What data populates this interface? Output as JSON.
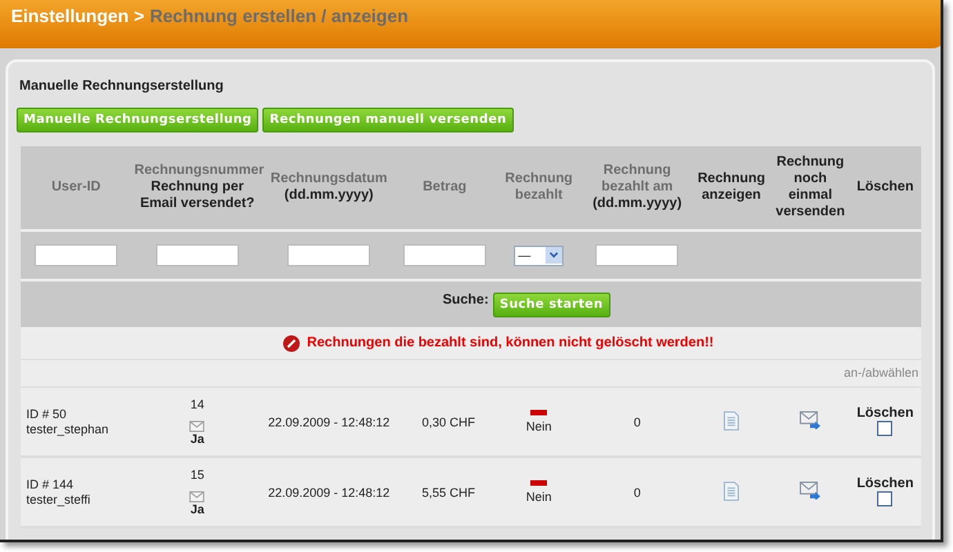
{
  "breadcrumb": {
    "root": "Einstellungen >",
    "current": "Rechnung erstellen / anzeigen"
  },
  "section_title": "Manuelle Rechnungserstellung",
  "buttons": [
    "Manuelle Rechnungserstellung",
    "Rechnungen manuell versenden"
  ],
  "table": {
    "columns": [
      {
        "label": "User-ID",
        "sortable": true
      },
      {
        "label": "Rechnungsnummer",
        "sublabel": "Rechnung per Email versendet?",
        "sortable": true
      },
      {
        "label": "Rechnungsdatum",
        "sublabel": "(dd.mm.yyyy)",
        "sortable": true
      },
      {
        "label": "Betrag",
        "sortable": true
      },
      {
        "label": "Rechnung bezahlt",
        "sortable": true
      },
      {
        "label": "Rechnung bezahlt am",
        "sublabel": "(dd.mm.yyyy)",
        "sortable": true
      },
      {
        "label": "Rechnung anzeigen",
        "sortable": false
      },
      {
        "label": "Rechnung noch einmal versenden",
        "sortable": false
      },
      {
        "label": "Löschen",
        "sortable": false
      }
    ],
    "filters": [
      {
        "kind": "text"
      },
      {
        "kind": "text"
      },
      {
        "kind": "text"
      },
      {
        "kind": "text"
      },
      {
        "kind": "select",
        "value": "—"
      },
      {
        "kind": "text"
      }
    ],
    "search": {
      "label": "Suche:",
      "button": "Suche starten"
    },
    "warning": "Rechnungen die bezahlt sind, können nicht gelöscht werden!!",
    "toggle_all": "an-/abwählen",
    "rows": [
      {
        "user_id": "ID # 50",
        "username": "tester_stephan",
        "number": "14",
        "emailed": "Ja",
        "date": "22.09.2009 - 12:48:12",
        "amount": "0,30 CHF",
        "paid": false,
        "paid_label": "Nein",
        "paid_on": "0",
        "delete_label": "Löschen",
        "checked": false
      },
      {
        "user_id": "ID # 144",
        "username": "tester_steffi",
        "number": "15",
        "emailed": "Ja",
        "date": "22.09.2009 - 12:48:12",
        "amount": "5,55 CHF",
        "paid": false,
        "paid_label": "Nein",
        "paid_on": "0",
        "delete_label": "Löschen",
        "checked": false
      }
    ]
  }
}
